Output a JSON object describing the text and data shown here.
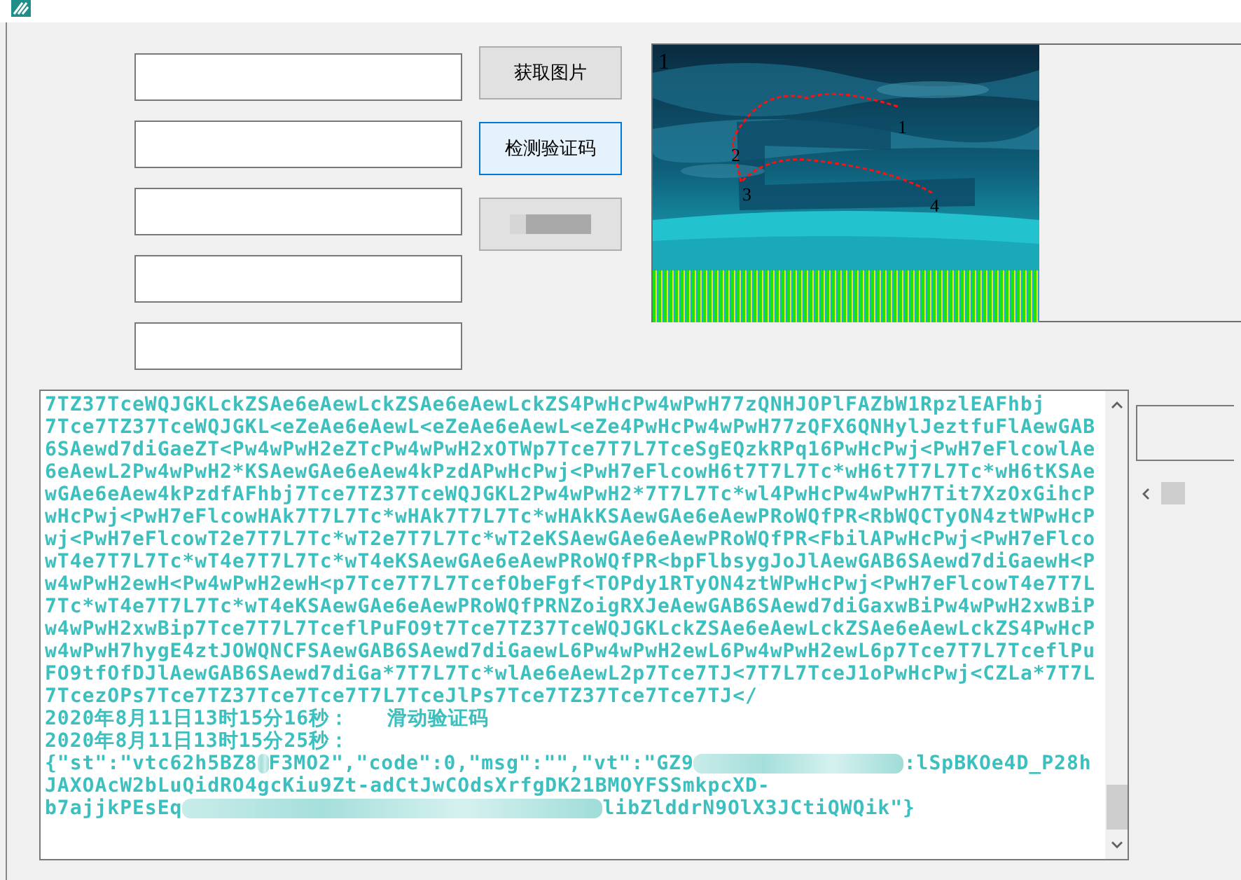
{
  "fields": [
    {
      "kind": "text"
    },
    {
      "kind": "text"
    },
    {
      "kind": "text"
    },
    {
      "kind": "text"
    },
    {
      "kind": "text"
    }
  ],
  "buttons": [
    {
      "kind": "text",
      "label": "获取图片",
      "focused": false
    },
    {
      "kind": "text",
      "label": "检测验证码",
      "focused": true
    },
    {
      "kind": "redacted",
      "focused": false
    }
  ],
  "preview": {
    "markers": [
      "1",
      "1",
      "2",
      "3",
      "4"
    ]
  },
  "log": {
    "lines": [
      [
        "7TZ37TceWQJGKLckZSAe6eAewLckZSAe6eAewLckZS4PwHcPw4wPwH77zQNHJOPlFAZbW1RpzlEAFhbj"
      ],
      [
        "7Tce7TZ37TceWQJGKL<eZeAe6eAewL<eZeAe6eAewL<eZe4PwHcPw4wPwH77zQFX6QNHylJeztfuFlAewGAB"
      ],
      [
        "6SAewd7diGaeZT<Pw4wPwH2eZTcPw4wPwH2xOTWp7Tce7T7L7TceSgEQzkRPq16PwHcPwj<PwH7eFlcowlAe"
      ],
      [
        "6eAewL2Pw4wPwH2*KSAewGAe6eAew4kPzdAPwHcPwj<PwH7eFlcowH6t7T7L7Tc*wH6t7T7L7Tc*wH6tKSAe"
      ],
      [
        "wGAe6eAew4kPzdfAFhbj7Tce7TZ37TceWQJGKL2Pw4wPwH2*7T7L7Tc*wl4PwHcPw4wPwH7Tit7XzOxGihcP"
      ],
      [
        "wHcPwj<PwH7eFlcowHAk7T7L7Tc*wHAk7T7L7Tc*wHAkKSAewGAe6eAewPRoWQfPR<RbWQCTyON4ztWPwHcP"
      ],
      [
        "wj<PwH7eFlcowT2e7T7L7Tc*wT2e7T7L7Tc*wT2eKSAewGAe6eAewPRoWQfPR<FbilAPwHcPwj<PwH7eFlco"
      ],
      [
        "wT4e7T7L7Tc*wT4e7T7L7Tc*wT4eKSAewGAe6eAewPRoWQfPR<bpFlbsygJoJlAewGAB6SAewd7diGaewH<P"
      ],
      [
        "w4wPwH2ewH<Pw4wPwH2ewH<p7Tce7T7L7TcefObeFgf<TOPdy1RTyON4ztWPwHcPwj<PwH7eFlcowT4e7T7L"
      ],
      [
        "7Tc*wT4e7T7L7Tc*wT4eKSAewGAe6eAewPRoWQfPRNZoigRXJeAewGAB6SAewd7diGaxwBiPw4wPwH2xwBiP"
      ],
      [
        "w4wPwH2xwBip7Tce7T7L7TceflPuFO9t7Tce7TZ37TceWQJGKLckZSAe6eAewLckZSAe6eAewLckZS4PwHcP"
      ],
      [
        "w4wPwH7hygE4ztJOWQNCFSAewGAB6SAewd7diGaewL6Pw4wPwH2ewL6Pw4wPwH2ewL6p7Tce7T7L7TceflPu"
      ],
      [
        "FO9tfOfDJlAewGAB6SAewd7diGa*7T7L7Tc*wlAe6eAewL2p7Tce7TJ<7T7L7TceJ1oPwHcPwj<CZLa*7T7L"
      ],
      [
        "7TcezOPs7Tce7TZ37Tce7Tce7T7L7TceJlPs7Tce7TZ37Tce7Tce7TJ</"
      ],
      [
        "2020年8月11日13时15分16秒：   滑动验证码"
      ],
      [
        "2020年8月11日13时15分25秒："
      ],
      [
        "{\"st\":\"vtc62h5BZ8",
        "F3MO2\",\"code\":0,\"msg\":\"\",\"vt\":\"GZ9",
        ":lSpBKOe4D_P28h"
      ],
      [
        "JAXOAcW2bLuQidRO4gcKiu9Zt-adCtJwCOdsXrfgDK21BMOYFSSmkpcXD-"
      ],
      [
        "b7ajjkPEsEq",
        "libZlddrN9OlX3JCtiQWQik\"}"
      ]
    ]
  }
}
